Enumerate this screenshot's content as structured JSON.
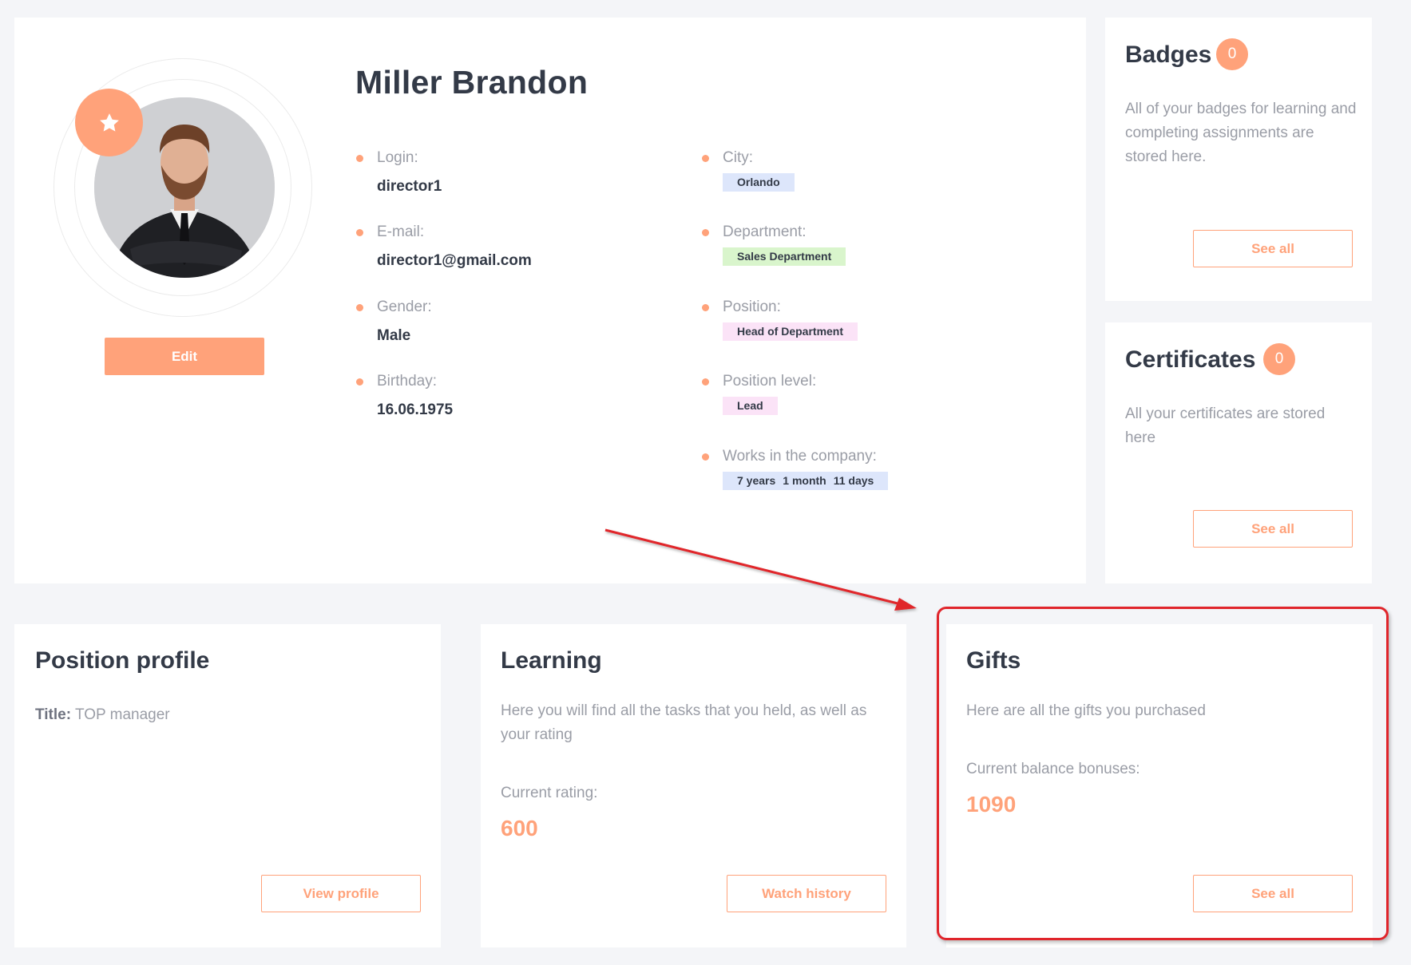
{
  "profile": {
    "name": "Miller Brandon",
    "edit_label": "Edit",
    "left_fields": [
      {
        "label": "Login:",
        "value": "director1"
      },
      {
        "label": "E-mail:",
        "value": "director1@gmail.com"
      },
      {
        "label": "Gender:",
        "value": "Male"
      },
      {
        "label": "Birthday:",
        "value": "16.06.1975"
      }
    ],
    "right_fields": [
      {
        "label": "City:",
        "value": "Orlando",
        "tag_color": "#dde6fb"
      },
      {
        "label": "Department:",
        "value": "Sales Department",
        "tag_color": "#d9f5cc"
      },
      {
        "label": "Position:",
        "value": "Head of Department",
        "tag_color": "#fbe3f7"
      },
      {
        "label": "Position level:",
        "value": "Lead",
        "tag_color": "#fbe3f7"
      },
      {
        "label": "Works in the company:",
        "tag_color": "#dde6fb",
        "years": "7 years",
        "months": "1 month",
        "days": "11 days"
      }
    ]
  },
  "badges": {
    "title": "Badges",
    "count": "0",
    "description": "All of your badges for learning and completing assignments are stored here.",
    "button": "See all"
  },
  "certificates": {
    "title": "Certificates",
    "count": "0",
    "description": "All your certificates are stored here",
    "button": "See all"
  },
  "position_profile": {
    "title": "Position profile",
    "title_label": "Title:",
    "title_value": "TOP manager",
    "button": "View profile"
  },
  "learning": {
    "title": "Learning",
    "description": "Here you will find all the tasks that you held, as well as your rating",
    "rating_label": "Current rating:",
    "rating_value": "600",
    "button": "Watch history"
  },
  "gifts": {
    "title": "Gifts",
    "description": "Here are all the gifts you purchased",
    "balance_label": "Current balance bonuses:",
    "balance_value": "1090",
    "button": "See all"
  },
  "colors": {
    "accent": "#ffa27a",
    "annotation_red": "#e0252b",
    "page_bg": "#f4f5f8"
  }
}
